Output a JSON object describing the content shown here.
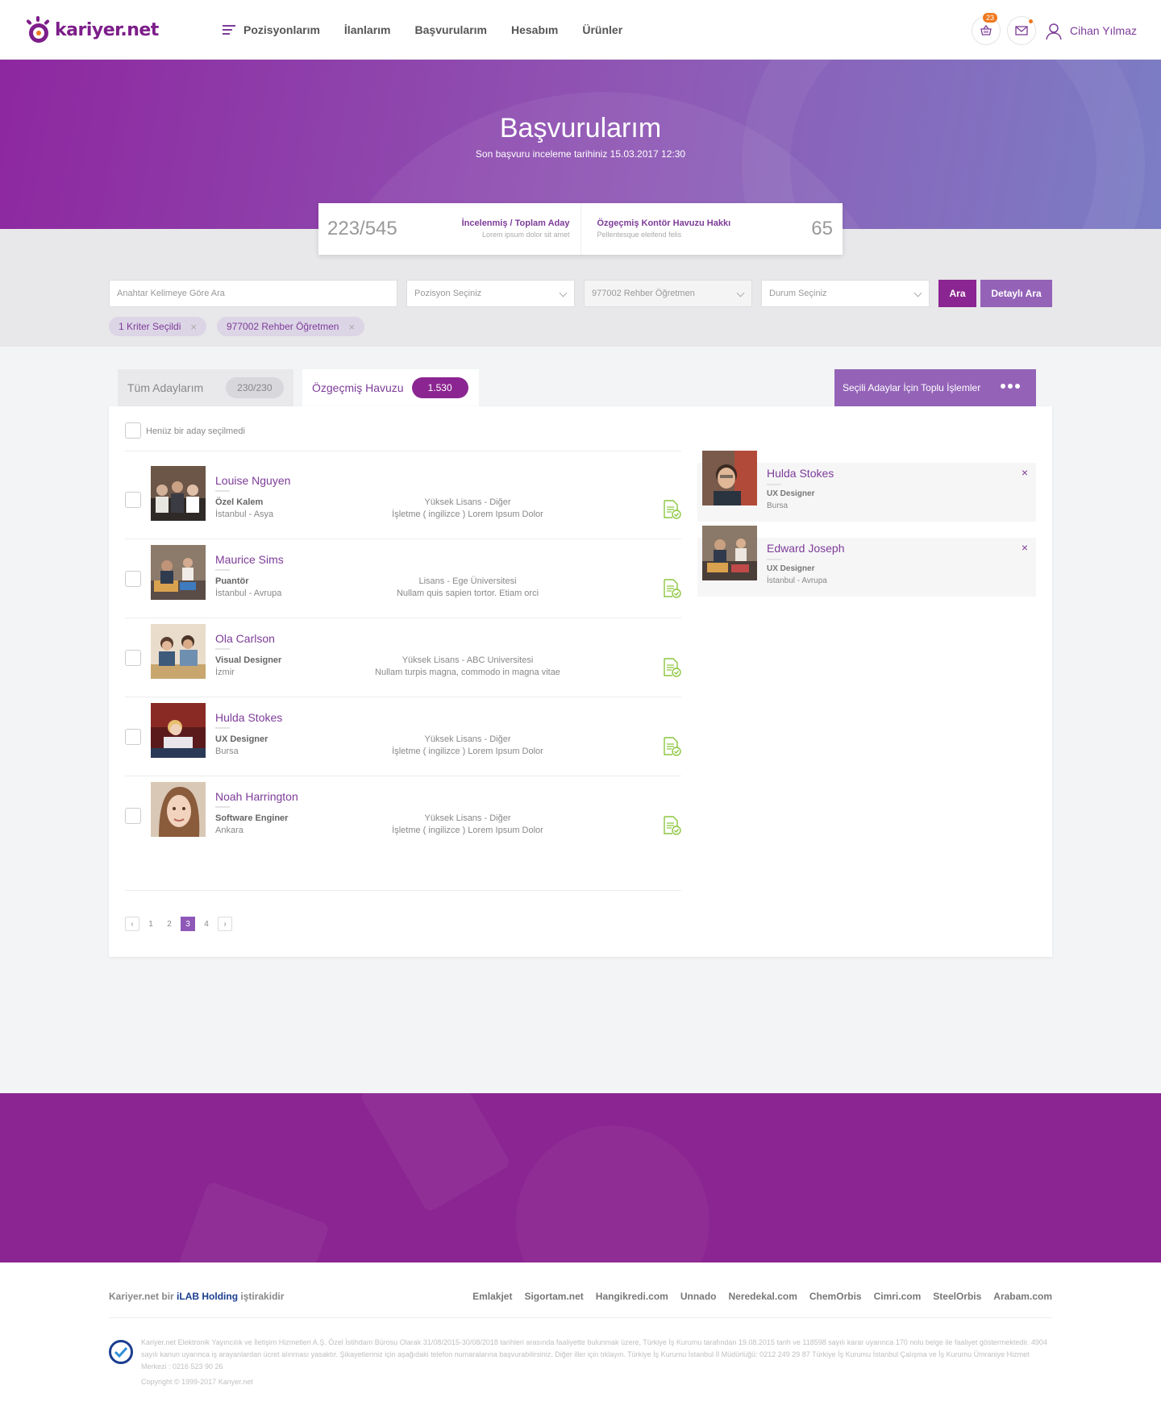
{
  "header": {
    "logo_text": "kariyer.net",
    "nav": [
      {
        "label": "Pozisyonlarım"
      },
      {
        "label": "İlanlarım"
      },
      {
        "label": "Başvurularım"
      },
      {
        "label": "Hesabım"
      },
      {
        "label": "Ürünler"
      }
    ],
    "basket_count": "23",
    "user_name": "Cihan Yılmaz"
  },
  "hero": {
    "title": "Başvurularım",
    "subtitle": "Son başvuru inceleme tarihiniz 15.03.2017 12:30"
  },
  "stats": {
    "reviewed_total": "223/545",
    "reviewed_label": "İncelenmiş  / Toplam Aday",
    "reviewed_sub": "Lorem ipsum dolor sit amet",
    "credit_label": "Özgeçmiş Kontör Havuzu Hakkı",
    "credit_sub": "Pellentesque eleifend felis",
    "credit_value": "65"
  },
  "filters": {
    "keyword_placeholder": "Anahtar Kelimeye Göre Ara",
    "position_placeholder": "Pozisyon Seçiniz",
    "selected_position": "977002 Rehber Öğretmen",
    "status_placeholder": "Durum Seçiniz",
    "search_label": "Ara",
    "detailed_search_label": "Detaylı Ara",
    "chips": [
      {
        "label": "1 Kriter Seçildi"
      },
      {
        "label": "977002 Rehber Öğretmen"
      }
    ]
  },
  "tabs": [
    {
      "label": "Tüm Adaylarım",
      "count": "230/230"
    },
    {
      "label": "Özgeçmiş Havuzu",
      "count": "1.530"
    }
  ],
  "bulk_actions_label": "Seçili Adaylar İçin Toplu İşlemler",
  "selection_note": "Henüz bir aday seçilmedi",
  "candidates": [
    {
      "name": "Louise Nguyen",
      "title": "Özel Kalem",
      "city": "İstanbul - Asya",
      "degree": "Yüksek Lisans - Diğer",
      "dept": "İşletme ( ingilizce ) Lorem Ipsum Dolor"
    },
    {
      "name": "Maurice Sims",
      "title": "Puantör",
      "city": "İstanbul - Avrupa",
      "degree": "Lisans - Ege Üniversitesi",
      "dept": "Nullam quis sapien tortor. Etiam orci"
    },
    {
      "name": "Ola Carlson",
      "title": "Visual Designer",
      "city": "İzmir",
      "degree": "Yüksek Lisans - ABC Universitesi",
      "dept": "Nullam turpis magna, commodo in magna vitae"
    },
    {
      "name": "Hulda Stokes",
      "title": "UX Designer",
      "city": "Bursa",
      "degree": "Yüksek Lisans - Diğer",
      "dept": "İşletme ( ingilizce ) Lorem Ipsum Dolor"
    },
    {
      "name": "Noah Harrington",
      "title": "Software Enginer",
      "city": "Ankara",
      "degree": "Yüksek Lisans - Diğer",
      "dept": "İşletme ( ingilizce ) Lorem Ipsum Dolor"
    }
  ],
  "pagination": {
    "pages": [
      "1",
      "2",
      "3",
      "4"
    ],
    "current": "3"
  },
  "selected": [
    {
      "name": "Hulda Stokes",
      "title": "UX Designer",
      "city": "Bursa"
    },
    {
      "name": "Edward Joseph",
      "title": "UX Designer",
      "city": "İstanbul - Avrupa"
    }
  ],
  "footer": {
    "brand_prefix": "Kariyer.net bir",
    "holding": "iLAB Holding",
    "brand_suffix": "iştirakidir",
    "links": [
      "Emlakjet",
      "Sigortam.net",
      "Hangikredi.com",
      "Unnado",
      "Neredekal.com",
      "ChemOrbis",
      "Cimri.com",
      "SteelOrbis",
      "Arabam.com"
    ],
    "legal": "Kariyer.net Elektronik Yayıncılık ve İletişim Hizmetleri A.Ş. Özel İstihdam Bürosu Olarak 31/08/2015-30/08/2018 tarihleri arasında faaliyette bulunmak üzere, Türkiye İş Kurumu tarafından 19.08.2015 tarih ve 118598 sayılı karar uyarınca 170 nolu belge ile faaliyet göstermektedir. 4904 sayılı kanun uyarınca iş arayanlardan ücret alınması yasaktır. Şikayetleriniz için aşağıdaki telefon numaralarına başvurabilirsiniz. Diğer iller için tıklayın. Türkiye İş Kurumu İstanbul İl Müdürlüğü: 0212 249 29 87 Türkiye İş Kurumu İstanbul Çalışma ve İş Kurumu Ümraniye Hizmet Merkezi : 0216 523 90 26",
    "copyright": "Copyright © 1999-2017 Kariyer.net"
  }
}
